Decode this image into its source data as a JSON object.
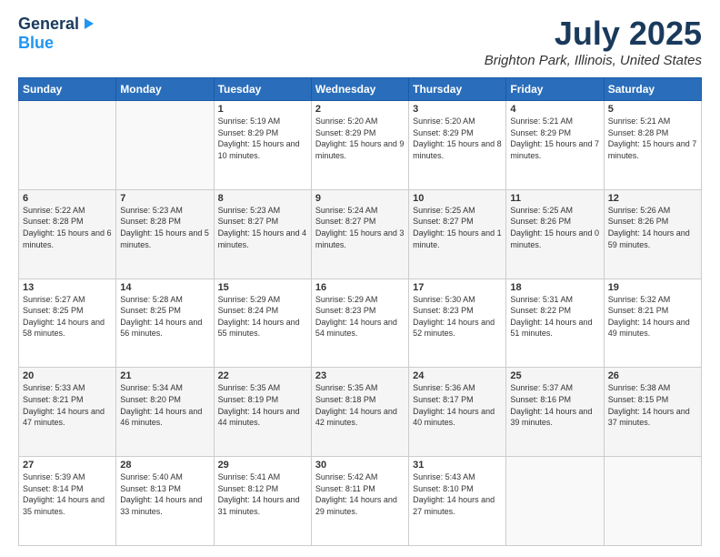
{
  "logo": {
    "line1": "General",
    "line2": "Blue"
  },
  "header": {
    "title": "July 2025",
    "subtitle": "Brighton Park, Illinois, United States"
  },
  "days_of_week": [
    "Sunday",
    "Monday",
    "Tuesday",
    "Wednesday",
    "Thursday",
    "Friday",
    "Saturday"
  ],
  "weeks": [
    [
      {
        "day": "",
        "info": ""
      },
      {
        "day": "",
        "info": ""
      },
      {
        "day": "1",
        "info": "Sunrise: 5:19 AM\nSunset: 8:29 PM\nDaylight: 15 hours\nand 10 minutes."
      },
      {
        "day": "2",
        "info": "Sunrise: 5:20 AM\nSunset: 8:29 PM\nDaylight: 15 hours\nand 9 minutes."
      },
      {
        "day": "3",
        "info": "Sunrise: 5:20 AM\nSunset: 8:29 PM\nDaylight: 15 hours\nand 8 minutes."
      },
      {
        "day": "4",
        "info": "Sunrise: 5:21 AM\nSunset: 8:29 PM\nDaylight: 15 hours\nand 7 minutes."
      },
      {
        "day": "5",
        "info": "Sunrise: 5:21 AM\nSunset: 8:28 PM\nDaylight: 15 hours\nand 7 minutes."
      }
    ],
    [
      {
        "day": "6",
        "info": "Sunrise: 5:22 AM\nSunset: 8:28 PM\nDaylight: 15 hours\nand 6 minutes."
      },
      {
        "day": "7",
        "info": "Sunrise: 5:23 AM\nSunset: 8:28 PM\nDaylight: 15 hours\nand 5 minutes."
      },
      {
        "day": "8",
        "info": "Sunrise: 5:23 AM\nSunset: 8:27 PM\nDaylight: 15 hours\nand 4 minutes."
      },
      {
        "day": "9",
        "info": "Sunrise: 5:24 AM\nSunset: 8:27 PM\nDaylight: 15 hours\nand 3 minutes."
      },
      {
        "day": "10",
        "info": "Sunrise: 5:25 AM\nSunset: 8:27 PM\nDaylight: 15 hours\nand 1 minute."
      },
      {
        "day": "11",
        "info": "Sunrise: 5:25 AM\nSunset: 8:26 PM\nDaylight: 15 hours\nand 0 minutes."
      },
      {
        "day": "12",
        "info": "Sunrise: 5:26 AM\nSunset: 8:26 PM\nDaylight: 14 hours\nand 59 minutes."
      }
    ],
    [
      {
        "day": "13",
        "info": "Sunrise: 5:27 AM\nSunset: 8:25 PM\nDaylight: 14 hours\nand 58 minutes."
      },
      {
        "day": "14",
        "info": "Sunrise: 5:28 AM\nSunset: 8:25 PM\nDaylight: 14 hours\nand 56 minutes."
      },
      {
        "day": "15",
        "info": "Sunrise: 5:29 AM\nSunset: 8:24 PM\nDaylight: 14 hours\nand 55 minutes."
      },
      {
        "day": "16",
        "info": "Sunrise: 5:29 AM\nSunset: 8:23 PM\nDaylight: 14 hours\nand 54 minutes."
      },
      {
        "day": "17",
        "info": "Sunrise: 5:30 AM\nSunset: 8:23 PM\nDaylight: 14 hours\nand 52 minutes."
      },
      {
        "day": "18",
        "info": "Sunrise: 5:31 AM\nSunset: 8:22 PM\nDaylight: 14 hours\nand 51 minutes."
      },
      {
        "day": "19",
        "info": "Sunrise: 5:32 AM\nSunset: 8:21 PM\nDaylight: 14 hours\nand 49 minutes."
      }
    ],
    [
      {
        "day": "20",
        "info": "Sunrise: 5:33 AM\nSunset: 8:21 PM\nDaylight: 14 hours\nand 47 minutes."
      },
      {
        "day": "21",
        "info": "Sunrise: 5:34 AM\nSunset: 8:20 PM\nDaylight: 14 hours\nand 46 minutes."
      },
      {
        "day": "22",
        "info": "Sunrise: 5:35 AM\nSunset: 8:19 PM\nDaylight: 14 hours\nand 44 minutes."
      },
      {
        "day": "23",
        "info": "Sunrise: 5:35 AM\nSunset: 8:18 PM\nDaylight: 14 hours\nand 42 minutes."
      },
      {
        "day": "24",
        "info": "Sunrise: 5:36 AM\nSunset: 8:17 PM\nDaylight: 14 hours\nand 40 minutes."
      },
      {
        "day": "25",
        "info": "Sunrise: 5:37 AM\nSunset: 8:16 PM\nDaylight: 14 hours\nand 39 minutes."
      },
      {
        "day": "26",
        "info": "Sunrise: 5:38 AM\nSunset: 8:15 PM\nDaylight: 14 hours\nand 37 minutes."
      }
    ],
    [
      {
        "day": "27",
        "info": "Sunrise: 5:39 AM\nSunset: 8:14 PM\nDaylight: 14 hours\nand 35 minutes."
      },
      {
        "day": "28",
        "info": "Sunrise: 5:40 AM\nSunset: 8:13 PM\nDaylight: 14 hours\nand 33 minutes."
      },
      {
        "day": "29",
        "info": "Sunrise: 5:41 AM\nSunset: 8:12 PM\nDaylight: 14 hours\nand 31 minutes."
      },
      {
        "day": "30",
        "info": "Sunrise: 5:42 AM\nSunset: 8:11 PM\nDaylight: 14 hours\nand 29 minutes."
      },
      {
        "day": "31",
        "info": "Sunrise: 5:43 AM\nSunset: 8:10 PM\nDaylight: 14 hours\nand 27 minutes."
      },
      {
        "day": "",
        "info": ""
      },
      {
        "day": "",
        "info": ""
      }
    ]
  ]
}
